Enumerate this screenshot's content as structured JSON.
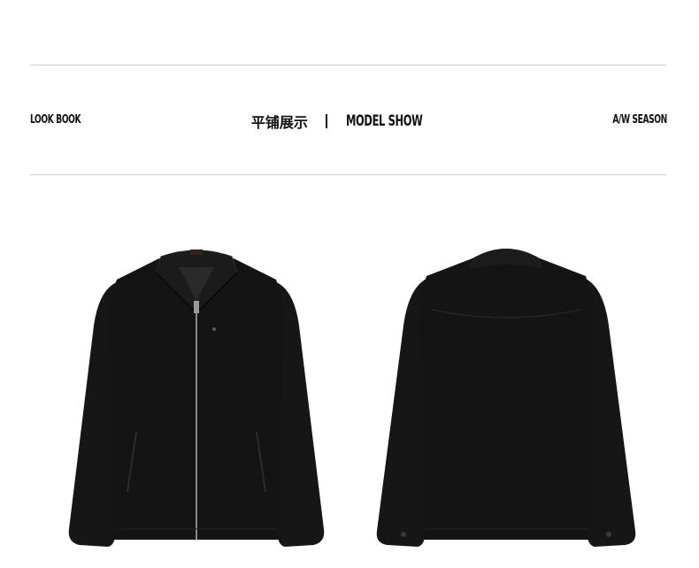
{
  "header": {
    "left_label": "LOOK BOOK",
    "title_cn": "平铺展示",
    "title_en": "MODEL SHOW",
    "right_label": "A/W SEASON"
  },
  "colors": {
    "garment": "#161616",
    "rule": "#cfcfcf",
    "zipper": "#8a8a8a"
  },
  "products": [
    {
      "view": "front",
      "icon": "jacket-front-icon"
    },
    {
      "view": "back",
      "icon": "jacket-back-icon"
    }
  ]
}
